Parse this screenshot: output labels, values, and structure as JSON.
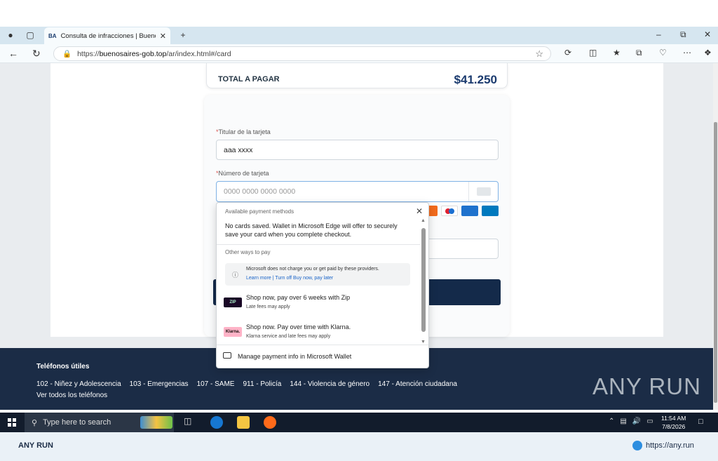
{
  "browser": {
    "tab_title": "Consulta de infracciones | Buenos",
    "tab_favicon": "BA",
    "url_prefix": "https://",
    "url_host": "buenosaires-gob.top",
    "url_path": "/ar/index.html#/card"
  },
  "summary": {
    "total_label": "TOTAL A PAGAR",
    "total_amount": "$41.250"
  },
  "form": {
    "cardholder_label": "Titular de la tarjeta",
    "cardholder_value": "aaa xxxx",
    "card_number_label": "Número de tarjeta",
    "card_number_placeholder": "0000 0000 0000 0000",
    "required_mark": "*"
  },
  "wallet_popup": {
    "header": "Available payment methods",
    "message": "No cards saved. Wallet in Microsoft Edge will offer to securely save your card when you complete checkout.",
    "other_ways": "Other ways to pay",
    "note": "Microsoft does not charge you or get paid by these providers.",
    "note_links": "Learn more | Turn off Buy now, pay later",
    "providers": [
      {
        "logo": "ZIP",
        "title": "Shop now, pay over 6 weeks with Zip",
        "subtitle": "Late fees may apply"
      },
      {
        "logo": "Klarna.",
        "title": "Shop now. Pay over time with Klarna.",
        "subtitle": "Klarna service and late fees may apply"
      }
    ],
    "manage": "Manage payment info in Microsoft Wallet"
  },
  "footer": {
    "title": "Teléfonos útiles",
    "phones": [
      "102 - Niñez y Adolescencia",
      "103 - Emergencias",
      "107 - SAME",
      "911 - Policía",
      "144 - Violencia de género",
      "147 - Atención ciudadana"
    ],
    "all_phones": "Ver todos los teléfonos",
    "watermark": "ANY RUN"
  },
  "taskbar": {
    "search_placeholder": "Type here to search",
    "time": "11:54 AM",
    "date": "7/8/2026"
  },
  "brandbar": {
    "left": "ANY RUN",
    "right": "https://any.run"
  }
}
